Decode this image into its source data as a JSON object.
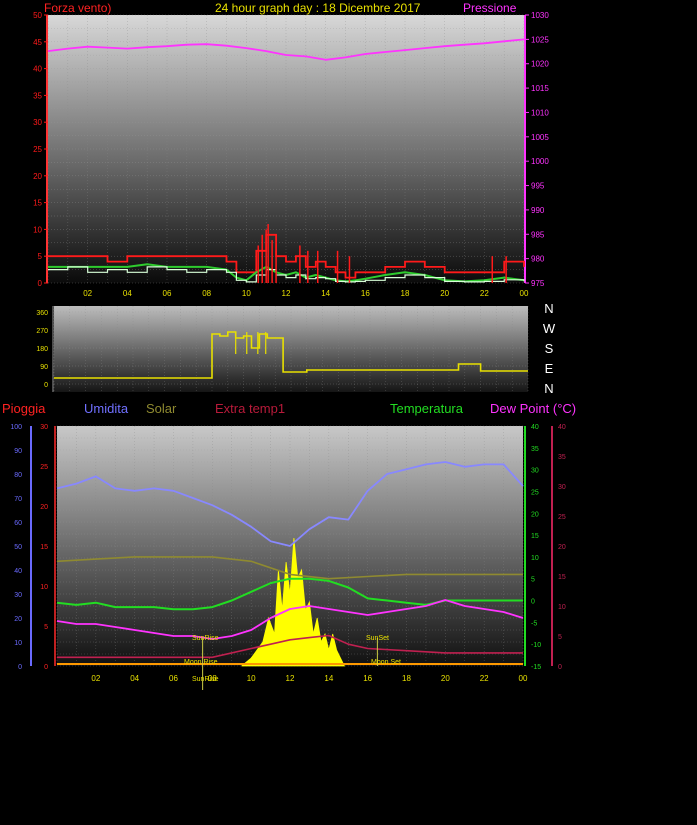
{
  "colors": {
    "wind": "#ff1a1a",
    "wind_avg": "#2ecc2e",
    "wind_gust": "#d8ffd8",
    "pressure": "#ff33ff",
    "direction": "#e8e000",
    "rain": "#6a6aff",
    "humidity": "#8888ff",
    "solar": "#8f8a30",
    "extra": "#c02050",
    "temp": "#22dd22",
    "dew": "#ff33ff",
    "sun": "#ffff00"
  },
  "header": {
    "left_title": "Forza vento)",
    "center_title": "24 hour graph day : 18 Dicembre 2017",
    "right_title": "Pressione"
  },
  "x_ticks": [
    "02",
    "04",
    "06",
    "08",
    "10",
    "12",
    "14",
    "16",
    "18",
    "20",
    "22",
    "00"
  ],
  "panel1": {
    "left_axis": [
      "0",
      "5",
      "10",
      "15",
      "20",
      "25",
      "30",
      "35",
      "40",
      "45",
      "50"
    ],
    "right_axis": [
      "975",
      "980",
      "985",
      "990",
      "995",
      "1000",
      "1005",
      "1010",
      "1015",
      "1020",
      "1025",
      "1030"
    ]
  },
  "panel2": {
    "left_axis": [
      "0",
      "90",
      "180",
      "270",
      "360"
    ],
    "compass": [
      "N",
      "W",
      "S",
      "E",
      "N"
    ]
  },
  "panel3": {
    "labels": {
      "rain": "Pioggia",
      "humidity": "Umidita",
      "solar": "Solar",
      "extra": "Extra temp1",
      "temp": "Temperatura",
      "dew": "Dew Point (°C)"
    },
    "axis_rain": [
      "0",
      "10",
      "20",
      "30",
      "40",
      "50",
      "60",
      "70",
      "80",
      "90",
      "100"
    ],
    "axis_solar": [
      "0",
      "5",
      "10",
      "15",
      "20",
      "25",
      "30"
    ],
    "axis_temp": [
      "-15",
      "-10",
      "-5",
      "0",
      "5",
      "10",
      "15",
      "20",
      "25",
      "30",
      "35",
      "40"
    ],
    "axis_dew": [
      "0",
      "5",
      "10",
      "15",
      "20",
      "25",
      "30",
      "35",
      "40"
    ],
    "annotations": {
      "sunrise": "SunRise",
      "sunset": "SunSet",
      "moonrise": "Moon Rise",
      "moonset": "Moon Set",
      "sunrise2": "SunRise"
    }
  },
  "chart_data": [
    {
      "type": "line",
      "title": "24 hour graph day : 18 Dicembre 2017",
      "x_unit": "hour",
      "ylim_left": [
        0,
        50
      ],
      "ylim_right": [
        975,
        1030
      ],
      "series": [
        {
          "name": "Pressione",
          "axis": "right",
          "x": [
            0,
            1,
            2,
            3,
            4,
            5,
            6,
            7,
            8,
            9,
            10,
            11,
            12,
            13,
            14,
            15,
            16,
            17,
            18,
            19,
            20,
            21,
            22,
            23,
            24
          ],
          "values": [
            1022.6,
            1023.1,
            1023.5,
            1023.3,
            1023.1,
            1023.4,
            1023.6,
            1023.9,
            1024.0,
            1023.7,
            1023.2,
            1022.6,
            1021.8,
            1021.5,
            1020.8,
            1021.3,
            1022.0,
            1022.4,
            1022.8,
            1023.2,
            1023.6,
            1023.9,
            1024.2,
            1024.6,
            1025.0
          ]
        }
      ],
      "unlabeled_series": [
        {
          "kind": "wind_gust_red",
          "x": [
            0,
            1,
            2,
            3,
            4,
            5,
            6,
            7,
            8,
            9,
            9.5,
            10,
            10.5,
            11,
            11.5,
            12,
            12.5,
            13,
            13.5,
            14,
            14.5,
            15,
            15.5,
            16,
            17,
            18,
            19,
            20,
            21,
            22,
            23,
            24
          ],
          "values": [
            5,
            5,
            5,
            4,
            5,
            5,
            5,
            5,
            5,
            4,
            2,
            2,
            6,
            9,
            5,
            4,
            5,
            3,
            4,
            3,
            2,
            1,
            2,
            2,
            3,
            4,
            3,
            2,
            2,
            2,
            4,
            3
          ]
        },
        {
          "kind": "wind_avg_green",
          "x": [
            0,
            1,
            2,
            3,
            4,
            5,
            6,
            7,
            8,
            9,
            9.5,
            10,
            10.5,
            11,
            11.5,
            12,
            12.5,
            13,
            13.5,
            14,
            14.5,
            15,
            15.5,
            16,
            17,
            18,
            19,
            20,
            21,
            22,
            23,
            24
          ],
          "values": [
            3,
            3,
            3,
            3,
            3,
            3.5,
            3,
            3,
            3,
            2.5,
            1,
            0.5,
            2,
            3,
            2,
            1.5,
            2,
            1,
            1.5,
            1,
            0.5,
            0.3,
            0.5,
            0.8,
            1.5,
            2,
            1.5,
            0.5,
            0.3,
            0.5,
            1,
            0.5
          ]
        },
        {
          "kind": "wind_light_green",
          "x": [
            0,
            1,
            2,
            3,
            4,
            5,
            6,
            7,
            8,
            9,
            9.5,
            10,
            10.5,
            11,
            11.5,
            12,
            12.5,
            13,
            13.5,
            14,
            14.5,
            15,
            15.5,
            16,
            17,
            18,
            19,
            20,
            21,
            22,
            23,
            24
          ],
          "values": [
            2.5,
            3,
            2,
            2.5,
            2,
            3,
            2.5,
            2,
            2.5,
            2,
            0.5,
            0.2,
            1.5,
            2.5,
            1.5,
            1,
            1.5,
            0.8,
            1,
            0.8,
            0.3,
            0.2,
            0.3,
            0.5,
            1,
            1.5,
            1,
            0.3,
            0.2,
            0.3,
            0.6,
            0.3
          ]
        }
      ]
    },
    {
      "type": "line",
      "ylim": [
        0,
        360
      ],
      "x_unit": "hour",
      "unlabeled_series": [
        {
          "kind": "wind_direction",
          "x": [
            0,
            5,
            9.9,
            10,
            10.5,
            11,
            11.5,
            12,
            12.5,
            13,
            13.5,
            14,
            14.5,
            15,
            16,
            20,
            24,
            25.5,
            25.6,
            26,
            27,
            28,
            29,
            30
          ],
          "values": [
            30,
            30,
            30,
            250,
            240,
            260,
            230,
            240,
            180,
            250,
            230,
            230,
            60,
            60,
            70,
            70,
            70,
            70,
            100,
            100,
            65,
            65,
            65,
            65
          ]
        }
      ]
    },
    {
      "type": "line",
      "x_unit": "hour",
      "ylim_rain": [
        0,
        100
      ],
      "ylim_temp": [
        -15,
        40
      ],
      "ylim_dew": [
        0,
        40
      ],
      "ylim_solar": [
        0,
        30
      ],
      "series": [
        {
          "name": "Umidita",
          "axis": "rain",
          "x": [
            0,
            1,
            2,
            3,
            4,
            5,
            6,
            7,
            8,
            9,
            10,
            11,
            12,
            13,
            14,
            15,
            16,
            17,
            18,
            19,
            20,
            21,
            22,
            23,
            24
          ],
          "values": [
            74,
            76,
            79,
            74,
            73,
            74,
            73,
            70,
            67,
            63,
            58,
            52,
            50,
            57,
            62,
            61,
            73,
            80,
            82,
            84,
            85,
            83,
            84,
            84,
            75
          ]
        },
        {
          "name": "Temperatura",
          "axis": "temp",
          "x": [
            0,
            1,
            2,
            3,
            4,
            5,
            6,
            7,
            8,
            9,
            10,
            11,
            12,
            13,
            14,
            15,
            16,
            17,
            18,
            19,
            20,
            21,
            22,
            23,
            24
          ],
          "values": [
            -0.5,
            -1,
            -0.5,
            -1.5,
            -1.5,
            -1.5,
            -2,
            -2,
            -1.5,
            0,
            2,
            4,
            5,
            5,
            4.5,
            3,
            0.5,
            0,
            -0.5,
            -1,
            0,
            0,
            0,
            0,
            0
          ]
        },
        {
          "name": "Dew Point (°C)",
          "axis": "dew",
          "x": [
            0,
            1,
            2,
            3,
            4,
            5,
            6,
            7,
            8,
            9,
            10,
            11,
            12,
            13,
            14,
            15,
            16,
            17,
            18,
            19,
            20,
            21,
            22,
            23,
            24
          ],
          "values": [
            7.5,
            7,
            7,
            6.5,
            6,
            5.5,
            5,
            5,
            4.5,
            5,
            6,
            8,
            9.5,
            10,
            9.5,
            9,
            8.5,
            9,
            9.5,
            10,
            11,
            10,
            9.5,
            9,
            8
          ]
        },
        {
          "name": "Solar",
          "axis": "temp",
          "x": [
            0,
            2,
            4,
            6,
            8,
            10,
            12,
            14,
            16,
            18,
            20,
            22,
            24
          ],
          "values": [
            9,
            9.5,
            10,
            10,
            10,
            9,
            6,
            5,
            5.5,
            6,
            6,
            6,
            6
          ]
        },
        {
          "name": "Extra temp1",
          "axis": "temp",
          "x": [
            0,
            2,
            4,
            6,
            8,
            10,
            11,
            12,
            13,
            14,
            15,
            16,
            18,
            20,
            22,
            24
          ],
          "values": [
            -13,
            -13,
            -13,
            -13,
            -13,
            -11,
            -10,
            -9,
            -8.5,
            -8,
            -10,
            -11,
            -11.5,
            -12,
            -12,
            -12
          ]
        }
      ],
      "unlabeled_series": [
        {
          "kind": "solar_radiation_fill",
          "axis": "solar",
          "x": [
            9.5,
            10,
            10.3,
            10.6,
            10.9,
            11.2,
            11.4,
            11.6,
            11.8,
            12,
            12.2,
            12.4,
            12.6,
            12.8,
            13,
            13.2,
            13.4,
            13.6,
            13.8,
            14,
            14.2,
            14.4,
            14.6,
            14.8
          ],
          "values": [
            0,
            1,
            2,
            3,
            6,
            4,
            12,
            7,
            13,
            9,
            16,
            11,
            12,
            7,
            8,
            4,
            6,
            3,
            4,
            2,
            4,
            2,
            1,
            0
          ]
        }
      ],
      "sun_events": {
        "sunrise_hour": 7.5,
        "sunset_hour": 16.5
      }
    }
  ]
}
